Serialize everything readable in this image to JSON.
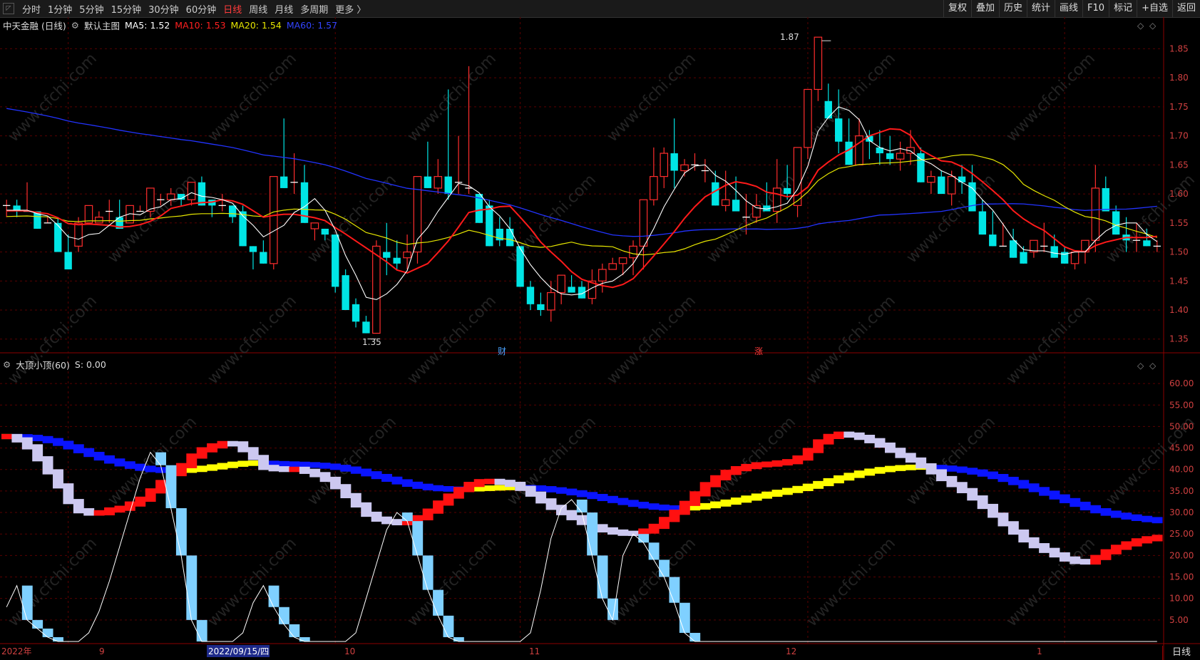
{
  "toolbar": {
    "periods": [
      "分时",
      "1分钟",
      "5分钟",
      "15分钟",
      "30分钟",
      "60分钟",
      "日线",
      "周线",
      "月线",
      "多周期",
      "更多 〉"
    ],
    "active_period": "日线",
    "tools": [
      "复权",
      "叠加",
      "历史",
      "统计",
      "画线",
      "F10",
      "标记",
      "+自选",
      "返回"
    ]
  },
  "main_legend": {
    "stock": "中天金融 (日线)",
    "template": "默认主图",
    "ma5": "MA5: 1.52",
    "ma10": "MA10: 1.53",
    "ma20": "MA20: 1.54",
    "ma60": "MA60: 1.57"
  },
  "indicator_legend": {
    "name": "大顶小顶(60)",
    "s": "S: 0.00"
  },
  "annotations": {
    "high": "1.87",
    "low": "1.35",
    "tag_cai": "财",
    "tag_zhang": "涨"
  },
  "price_axis": [
    "1.85",
    "1.80",
    "1.75",
    "1.70",
    "1.65",
    "1.60",
    "1.55",
    "1.50",
    "1.45",
    "1.40",
    "1.35"
  ],
  "indicator_axis": [
    "60.00",
    "55.00",
    "50.00",
    "45.00",
    "40.00",
    "35.00",
    "30.00",
    "25.00",
    "20.00",
    "15.00",
    "10.00",
    "5.00"
  ],
  "time_axis": [
    "2022年",
    "9",
    "2022/09/15/四",
    "10",
    "11",
    "12",
    "1"
  ],
  "bottom_right": "日线",
  "watermark": "www.cfchi.com",
  "colors": {
    "up": "#ff2d2d",
    "down": "#00e5e5",
    "ma5": "#ffffff",
    "ma10": "#ff1a1a",
    "ma20": "#e6e600",
    "ma60": "#2233ff"
  },
  "chart_data": [
    {
      "type": "candlestick",
      "title": "中天金融 (日线)",
      "ylim": [
        1.33,
        1.88
      ],
      "candles": [
        [
          1.58,
          1.59,
          1.56,
          1.58
        ],
        [
          1.58,
          1.59,
          1.56,
          1.57
        ],
        [
          1.57,
          1.62,
          1.57,
          1.57
        ],
        [
          1.57,
          1.57,
          1.55,
          1.54
        ],
        [
          1.55,
          1.56,
          1.55,
          1.55
        ],
        [
          1.55,
          1.56,
          1.51,
          1.5
        ],
        [
          1.5,
          1.53,
          1.5,
          1.47
        ],
        [
          1.51,
          1.56,
          1.5,
          1.55
        ],
        [
          1.55,
          1.58,
          1.55,
          1.58
        ],
        [
          1.55,
          1.57,
          1.55,
          1.56
        ],
        [
          1.57,
          1.59,
          1.55,
          1.57
        ],
        [
          1.56,
          1.59,
          1.54,
          1.54
        ],
        [
          1.55,
          1.56,
          1.55,
          1.58
        ],
        [
          1.57,
          1.58,
          1.57,
          1.57
        ],
        [
          1.57,
          1.59,
          1.56,
          1.61
        ],
        [
          1.59,
          1.6,
          1.58,
          1.59
        ],
        [
          1.59,
          1.61,
          1.58,
          1.6
        ],
        [
          1.6,
          1.59,
          1.58,
          1.59
        ],
        [
          1.59,
          1.62,
          1.58,
          1.62
        ],
        [
          1.62,
          1.63,
          1.58,
          1.58
        ],
        [
          1.59,
          1.59,
          1.56,
          1.58
        ],
        [
          1.58,
          1.6,
          1.57,
          1.58
        ],
        [
          1.58,
          1.58,
          1.55,
          1.56
        ],
        [
          1.57,
          1.58,
          1.56,
          1.51
        ],
        [
          1.51,
          1.51,
          1.47,
          1.5
        ],
        [
          1.5,
          1.52,
          1.48,
          1.48
        ],
        [
          1.48,
          1.61,
          1.47,
          1.63
        ],
        [
          1.63,
          1.73,
          1.61,
          1.61
        ],
        [
          1.62,
          1.67,
          1.6,
          1.62
        ],
        [
          1.62,
          1.65,
          1.55,
          1.55
        ],
        [
          1.54,
          1.54,
          1.52,
          1.55
        ],
        [
          1.54,
          1.54,
          1.52,
          1.53
        ],
        [
          1.53,
          1.52,
          1.43,
          1.44
        ],
        [
          1.46,
          1.47,
          1.4,
          1.4
        ],
        [
          1.41,
          1.42,
          1.37,
          1.38
        ],
        [
          1.38,
          1.39,
          1.36,
          1.36
        ],
        [
          1.36,
          1.52,
          1.36,
          1.51
        ],
        [
          1.5,
          1.55,
          1.46,
          1.49
        ],
        [
          1.49,
          1.52,
          1.47,
          1.48
        ],
        [
          1.49,
          1.53,
          1.47,
          1.5
        ],
        [
          1.5,
          1.63,
          1.48,
          1.63
        ],
        [
          1.63,
          1.69,
          1.61,
          1.61
        ],
        [
          1.61,
          1.66,
          1.6,
          1.63
        ],
        [
          1.63,
          1.78,
          1.59,
          1.6
        ],
        [
          1.62,
          1.7,
          1.6,
          1.62
        ],
        [
          1.61,
          1.82,
          1.6,
          1.61
        ],
        [
          1.6,
          1.59,
          1.55,
          1.55
        ],
        [
          1.58,
          1.59,
          1.54,
          1.51
        ],
        [
          1.54,
          1.56,
          1.51,
          1.52
        ],
        [
          1.54,
          1.56,
          1.52,
          1.51
        ],
        [
          1.51,
          1.49,
          1.44,
          1.44
        ],
        [
          1.44,
          1.45,
          1.4,
          1.41
        ],
        [
          1.41,
          1.43,
          1.39,
          1.4
        ],
        [
          1.4,
          1.45,
          1.38,
          1.43
        ],
        [
          1.43,
          1.46,
          1.41,
          1.46
        ],
        [
          1.44,
          1.46,
          1.43,
          1.43
        ],
        [
          1.44,
          1.45,
          1.43,
          1.42
        ],
        [
          1.42,
          1.47,
          1.41,
          1.45
        ],
        [
          1.45,
          1.48,
          1.43,
          1.47
        ],
        [
          1.47,
          1.49,
          1.47,
          1.48
        ],
        [
          1.48,
          1.49,
          1.46,
          1.49
        ],
        [
          1.49,
          1.52,
          1.46,
          1.51
        ],
        [
          1.51,
          1.55,
          1.47,
          1.59
        ],
        [
          1.59,
          1.68,
          1.58,
          1.63
        ],
        [
          1.63,
          1.68,
          1.61,
          1.67
        ],
        [
          1.67,
          1.73,
          1.61,
          1.64
        ],
        [
          1.64,
          1.66,
          1.63,
          1.65
        ],
        [
          1.65,
          1.67,
          1.64,
          1.65
        ],
        [
          1.64,
          1.66,
          1.62,
          1.64
        ],
        [
          1.62,
          1.64,
          1.6,
          1.58
        ],
        [
          1.58,
          1.64,
          1.57,
          1.59
        ],
        [
          1.59,
          1.63,
          1.58,
          1.57
        ],
        [
          1.56,
          1.6,
          1.53,
          1.56
        ],
        [
          1.56,
          1.6,
          1.55,
          1.58
        ],
        [
          1.58,
          1.62,
          1.57,
          1.57
        ],
        [
          1.57,
          1.66,
          1.55,
          1.61
        ],
        [
          1.61,
          1.65,
          1.59,
          1.6
        ],
        [
          1.58,
          1.61,
          1.56,
          1.68
        ],
        [
          1.68,
          1.75,
          1.66,
          1.78
        ],
        [
          1.78,
          1.87,
          1.76,
          1.87
        ],
        [
          1.76,
          1.79,
          1.75,
          1.73
        ],
        [
          1.73,
          1.78,
          1.67,
          1.69
        ],
        [
          1.69,
          1.73,
          1.66,
          1.65
        ],
        [
          1.65,
          1.73,
          1.67,
          1.7
        ],
        [
          1.7,
          1.71,
          1.66,
          1.69
        ],
        [
          1.68,
          1.71,
          1.65,
          1.67
        ],
        [
          1.67,
          1.7,
          1.65,
          1.66
        ],
        [
          1.66,
          1.69,
          1.64,
          1.67
        ],
        [
          1.67,
          1.71,
          1.65,
          1.68
        ],
        [
          1.67,
          1.68,
          1.62,
          1.62
        ],
        [
          1.62,
          1.64,
          1.6,
          1.63
        ],
        [
          1.63,
          1.64,
          1.6,
          1.6
        ],
        [
          1.6,
          1.64,
          1.58,
          1.63
        ],
        [
          1.63,
          1.65,
          1.6,
          1.62
        ],
        [
          1.62,
          1.65,
          1.58,
          1.57
        ],
        [
          1.57,
          1.59,
          1.53,
          1.53
        ],
        [
          1.53,
          1.57,
          1.51,
          1.51
        ],
        [
          1.51,
          1.55,
          1.51,
          1.51
        ],
        [
          1.52,
          1.54,
          1.5,
          1.49
        ],
        [
          1.5,
          1.51,
          1.49,
          1.48
        ],
        [
          1.5,
          1.52,
          1.49,
          1.52
        ],
        [
          1.51,
          1.55,
          1.5,
          1.51
        ],
        [
          1.51,
          1.53,
          1.49,
          1.49
        ],
        [
          1.5,
          1.51,
          1.48,
          1.48
        ],
        [
          1.48,
          1.5,
          1.47,
          1.5
        ],
        [
          1.5,
          1.52,
          1.48,
          1.52
        ],
        [
          1.52,
          1.65,
          1.5,
          1.61
        ],
        [
          1.61,
          1.63,
          1.57,
          1.57
        ],
        [
          1.57,
          1.58,
          1.53,
          1.53
        ],
        [
          1.53,
          1.56,
          1.5,
          1.52
        ],
        [
          1.52,
          1.55,
          1.5,
          1.52
        ],
        [
          1.52,
          1.54,
          1.51,
          1.51
        ],
        [
          1.51,
          1.52,
          1.5,
          1.51
        ]
      ]
    },
    {
      "type": "line",
      "title": "大顶小顶(60)",
      "ylim": [
        0,
        63
      ],
      "series": [
        {
          "name": "S",
          "values": [
            8,
            13,
            5,
            3,
            1,
            0,
            0,
            0,
            2,
            7,
            14,
            22,
            30,
            38,
            44,
            41,
            31,
            20,
            5,
            0,
            0,
            0,
            0,
            2,
            9,
            13,
            8,
            4,
            1,
            0,
            0,
            0,
            0,
            0,
            2,
            10,
            18,
            26,
            30,
            28,
            20,
            12,
            6,
            1,
            0,
            0,
            0,
            0,
            0,
            0,
            0,
            2,
            12,
            24,
            31,
            33,
            30,
            20,
            10,
            5,
            20,
            25,
            23,
            19,
            15,
            9,
            2,
            0,
            0,
            0,
            0,
            0,
            0,
            0,
            0,
            0,
            0,
            0,
            0,
            0,
            0,
            0,
            0,
            0,
            0,
            0,
            0,
            0,
            0,
            0,
            0,
            0,
            0,
            0,
            0,
            0,
            0,
            0,
            0,
            0,
            0,
            0,
            0,
            0,
            0,
            0,
            0,
            0,
            0,
            0,
            0,
            0,
            0
          ]
        }
      ]
    }
  ]
}
